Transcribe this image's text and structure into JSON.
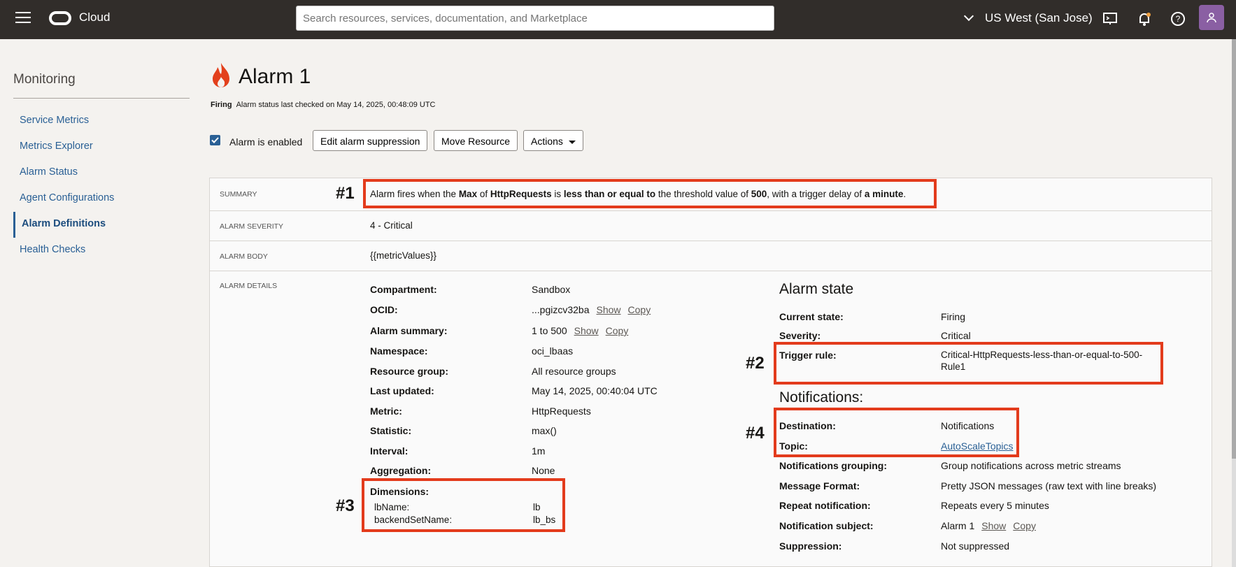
{
  "topbar": {
    "brand": "Cloud",
    "search_placeholder": "Search resources, services, documentation, and Marketplace",
    "region": "US West (San Jose)"
  },
  "sidebar": {
    "title": "Monitoring",
    "items": [
      {
        "label": "Service Metrics"
      },
      {
        "label": "Metrics Explorer"
      },
      {
        "label": "Alarm Status"
      },
      {
        "label": "Agent Configurations"
      },
      {
        "label": "Alarm Definitions"
      },
      {
        "label": "Health Checks"
      }
    ]
  },
  "page": {
    "title": "Alarm 1",
    "status": "Firing",
    "status_text": "Alarm status last checked on May 14, 2025, 00:48:09 UTC"
  },
  "toolbar": {
    "enabled_label": "Alarm is enabled",
    "edit_suppression": "Edit alarm suppression",
    "move_resource": "Move Resource",
    "actions": "Actions"
  },
  "summary": {
    "label": "SUMMARY",
    "parts": [
      "Alarm fires when the ",
      "Max",
      " of ",
      "HttpRequests",
      " is ",
      "less than or equal to",
      " the threshold value of ",
      "500",
      ", with a trigger delay of ",
      "a minute",
      "."
    ]
  },
  "severity": {
    "label": "ALARM SEVERITY",
    "value": "4 - Critical"
  },
  "body": {
    "label": "ALARM BODY",
    "value": "{{metricValues}}"
  },
  "details": {
    "label": "ALARM DETAILS",
    "compartment": {
      "k": "Compartment:",
      "v": "Sandbox"
    },
    "ocid": {
      "k": "OCID:",
      "v": "...pgizcv32ba",
      "show": "Show",
      "copy": "Copy"
    },
    "summary": {
      "k": "Alarm summary:",
      "v": "1 to 500",
      "show": "Show",
      "copy": "Copy"
    },
    "namespace": {
      "k": "Namespace:",
      "v": "oci_lbaas"
    },
    "resource_group": {
      "k": "Resource group:",
      "v": "All resource groups"
    },
    "last_updated": {
      "k": "Last updated:",
      "v": "May 14, 2025, 00:40:04 UTC"
    },
    "metric": {
      "k": "Metric:",
      "v": "HttpRequests"
    },
    "statistic": {
      "k": "Statistic:",
      "v": "max()"
    },
    "interval": {
      "k": "Interval:",
      "v": "1m"
    },
    "aggregation": {
      "k": "Aggregation:",
      "v": "None"
    },
    "dimensions": {
      "k": "Dimensions:",
      "rows": [
        {
          "k": "lbName:",
          "v": "lb"
        },
        {
          "k": "backendSetName:",
          "v": "lb_bs"
        }
      ]
    }
  },
  "alarm_state": {
    "title": "Alarm state",
    "current_state": {
      "k": "Current state:",
      "v": "Firing"
    },
    "severity": {
      "k": "Severity:",
      "v": "Critical"
    },
    "trigger_rule": {
      "k": "Trigger rule:",
      "v1": "Critical-HttpRequests-less-than-or-equal-to-500-",
      "v2": "Rule1"
    }
  },
  "notifications": {
    "title": "Notifications:",
    "destination": {
      "k": "Destination:",
      "v": "Notifications"
    },
    "topic": {
      "k": "Topic:",
      "v": "AutoScaleTopics"
    },
    "grouping": {
      "k": "Notifications grouping:",
      "v": "Group notifications across metric streams"
    },
    "format": {
      "k": "Message Format:",
      "v": "Pretty JSON messages (raw text with line breaks)"
    },
    "repeat": {
      "k": "Repeat notification:",
      "v": "Repeats every 5 minutes"
    },
    "subject": {
      "k": "Notification subject:",
      "v": "Alarm 1",
      "show": "Show",
      "copy": "Copy"
    },
    "suppression": {
      "k": "Suppression:",
      "v": "Not suppressed"
    }
  },
  "annotations": [
    "#1",
    "#2",
    "#3",
    "#4"
  ],
  "colors": {
    "highlight": "#e33b1c",
    "link": "#2a6095",
    "topbar": "#312d2a"
  }
}
